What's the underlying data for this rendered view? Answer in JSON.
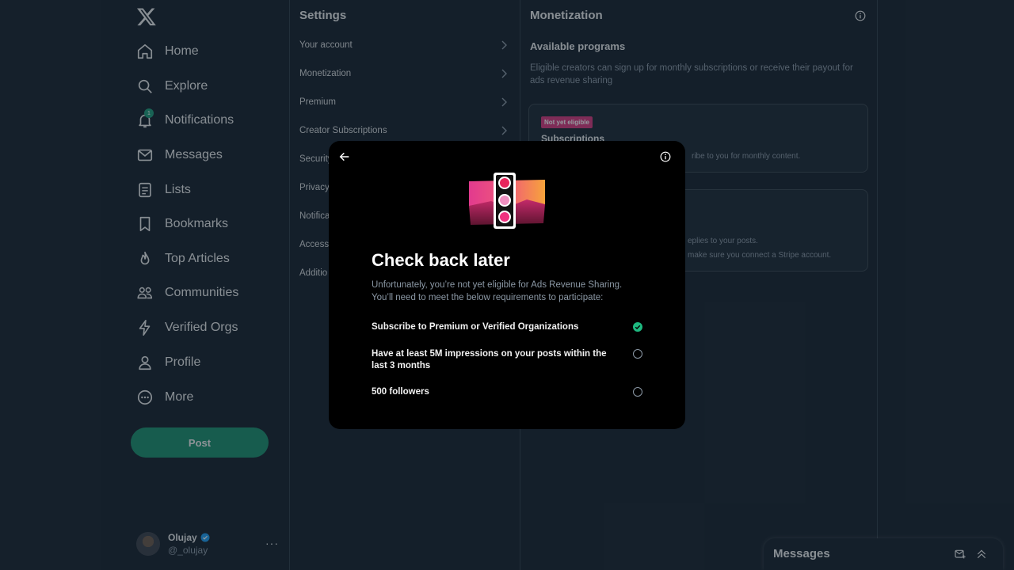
{
  "colors": {
    "background": "#15202b",
    "accent": "#1b8f6c",
    "badge": "#d6377d",
    "check": "#1eb980"
  },
  "nav": {
    "logo": "x-logo-icon",
    "items": [
      {
        "label": "Home",
        "icon": "home-icon"
      },
      {
        "label": "Explore",
        "icon": "search-icon"
      },
      {
        "label": "Notifications",
        "icon": "bell-icon",
        "badge": "1"
      },
      {
        "label": "Messages",
        "icon": "mail-icon"
      },
      {
        "label": "Lists",
        "icon": "list-icon"
      },
      {
        "label": "Bookmarks",
        "icon": "bookmark-icon"
      },
      {
        "label": "Top Articles",
        "icon": "flame-icon"
      },
      {
        "label": "Communities",
        "icon": "people-icon"
      },
      {
        "label": "Verified Orgs",
        "icon": "lightning-icon"
      },
      {
        "label": "Profile",
        "icon": "person-icon"
      },
      {
        "label": "More",
        "icon": "more-circle-icon"
      }
    ],
    "post_label": "Post",
    "account": {
      "name": "Olujay",
      "handle": "@_olujay",
      "more": "···"
    }
  },
  "settings": {
    "title": "Settings",
    "items": [
      {
        "label": "Your account"
      },
      {
        "label": "Monetization"
      },
      {
        "label": "Premium"
      },
      {
        "label": "Creator Subscriptions"
      },
      {
        "label": "Security"
      },
      {
        "label": "Privacy"
      },
      {
        "label": "Notifica"
      },
      {
        "label": "Access"
      },
      {
        "label": "Additio"
      }
    ]
  },
  "monetization": {
    "title": "Monetization",
    "section_title": "Available programs",
    "section_desc": "Eligible creators can sign up for monthly subscriptions or receive their payout for ads revenue sharing",
    "cards": [
      {
        "badge": "Not yet eligible",
        "title": "Subscriptions",
        "text": "ribe to you for monthly content."
      },
      {
        "line1": "eplies to your posts.",
        "line2": "make sure you connect a Stripe account."
      }
    ]
  },
  "drawer": {
    "title": "Messages"
  },
  "modal": {
    "title": "Check back later",
    "description": "Unfortunately, you’re not yet eligible for Ads Revenue Sharing. You’ll need to meet the below requirements to participate:",
    "requirements": [
      {
        "text": "Subscribe to Premium or Verified Organizations",
        "met": true
      },
      {
        "text": "Have at least 5M impressions on your posts within the last 3 months",
        "met": false
      },
      {
        "text": "500 followers",
        "met": false
      }
    ]
  }
}
